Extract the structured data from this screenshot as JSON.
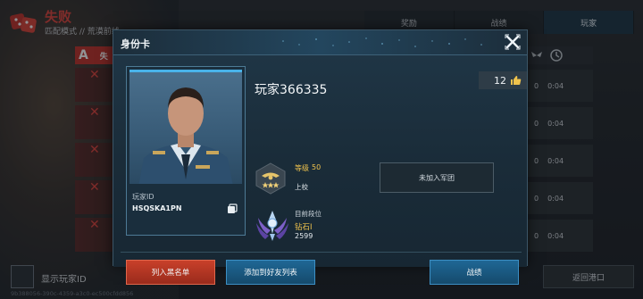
{
  "result": {
    "title": "失败",
    "mode": "匹配模式 // 荒漠前线"
  },
  "tabs": [
    {
      "label": "奖励"
    },
    {
      "label": "战绩"
    },
    {
      "label": "玩家",
      "active": true
    }
  ],
  "list": {
    "header_letter": "A",
    "header_text": "失"
  },
  "stats": {
    "rows": [
      {
        "kills": "0",
        "time": "0:04"
      },
      {
        "kills": "0",
        "time": "0:04"
      },
      {
        "kills": "0",
        "time": "0:04"
      },
      {
        "kills": "0",
        "time": "0:04"
      },
      {
        "kills": "0",
        "time": "0:04"
      }
    ]
  },
  "footer": {
    "show_id_label": "显示玩家ID",
    "uuid": "9b388056-390c-4359-a3c0-ec500cfdd856",
    "return_label": "返回港口"
  },
  "card": {
    "title": "身份卡",
    "player_name": "玩家366335",
    "likes": "12",
    "player_id_label": "玩家ID",
    "player_id_value": "HSQSKA1PN",
    "level_label": "等级",
    "level_value": "50",
    "rank_name": "上校",
    "tier_label": "目前段位",
    "tier_name": "钻石I",
    "tier_score": "2599",
    "legion_label": "未加入军团",
    "blacklist_label": "列入黑名单",
    "add_friend_label": "添加到好友列表",
    "record_label": "战绩"
  },
  "colors": {
    "accent_blue": "#49b3ea",
    "loss_red": "#e0463e",
    "gold": "#f0c34d",
    "blacklist_red": "#c8402a",
    "friend_blue": "#1f6795"
  },
  "icons": {
    "result": "dice-icon",
    "close": "close-icon",
    "copy": "copy-icon",
    "like": "thumbs-up-icon",
    "rank": "rank-badge-icon",
    "tier": "diamond-tier-icon"
  }
}
